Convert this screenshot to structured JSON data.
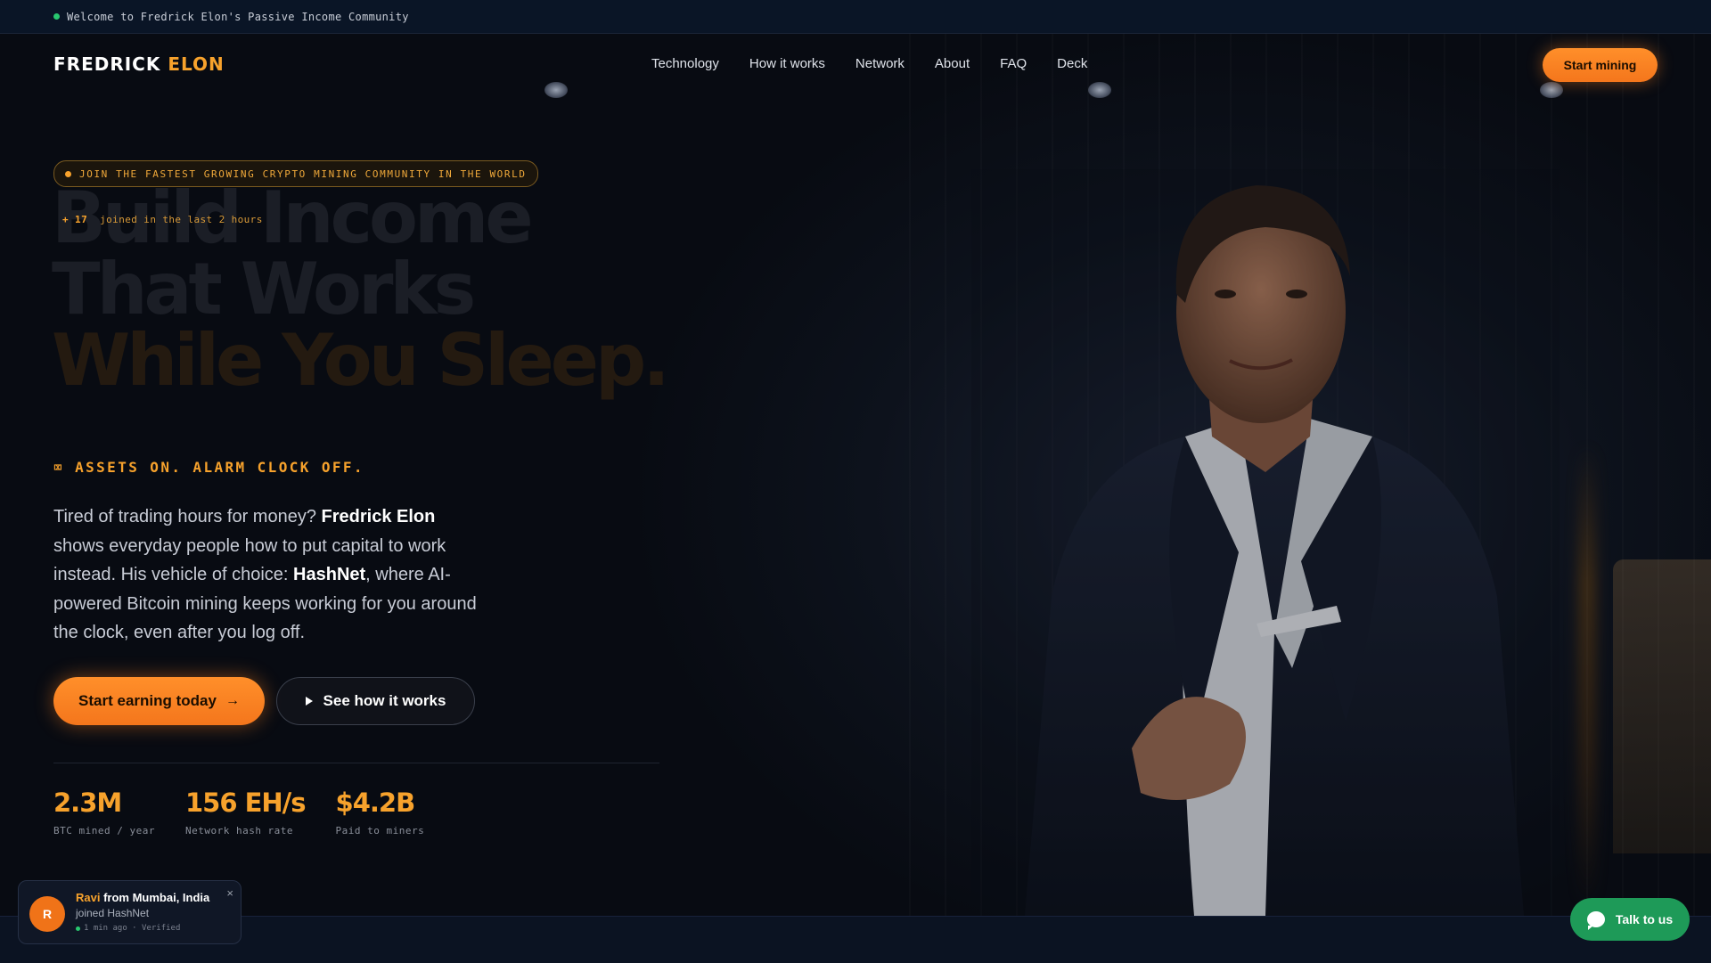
{
  "topbar": {
    "message": "Welcome to Fredrick Elon's Passive Income Community"
  },
  "nav": {
    "logo_main": "FREDRICK",
    "logo_accent": "ELON",
    "items": [
      "Technology",
      "How it works",
      "Network",
      "About",
      "FAQ",
      "Deck"
    ],
    "cta": "Start mining"
  },
  "hero": {
    "pill": "JOIN THE FASTEST GROWING CRYPTO MINING COMMUNITY IN THE WORLD",
    "joined_prefix": "+ 17",
    "joined_suffix": "joined in the last 2 hours",
    "headline": [
      "Build Income",
      "That Works",
      "While You Sleep."
    ],
    "tagline": "⌧ ASSETS ON. ALARM CLOCK OFF.",
    "para_1": "Tired of trading hours for money? ",
    "para_name": "Fredrick Elon",
    "para_2": " shows everyday people how to put capital to work instead. His vehicle of choice: ",
    "para_brand": "HashNet",
    "para_3": ", where AI-powered Bitcoin mining keeps working for you around the clock, even after you log off.",
    "cta_primary": "Start earning today",
    "cta_primary_icon": "arrow-right-icon",
    "cta_secondary": "See how it works",
    "cta_secondary_icon": "play-icon"
  },
  "stats": [
    {
      "value": "2.3M",
      "label": "BTC mined / year"
    },
    {
      "value": "156 EH/s",
      "label": "Network hash rate"
    },
    {
      "value": "$4.2B",
      "label": "Paid to miners"
    }
  ],
  "toast": {
    "avatar": "R",
    "name": "Ravi",
    "location": " from Mumbai, India",
    "action": "joined HashNet",
    "meta": "1 min ago · Verified",
    "close": "×"
  },
  "chat": {
    "label": "Talk to us",
    "icon": "chat-bubble-icon"
  },
  "colors": {
    "accent": "#f7a22c",
    "button": "#ff8f2a",
    "chat": "#1e9a58",
    "online": "#28c76f"
  }
}
